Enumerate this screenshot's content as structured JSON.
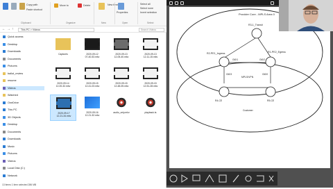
{
  "ribbon": {
    "copy_path": "Copy path",
    "paste_shortcut": "Paste shortcut",
    "move_to": "Move to",
    "delete": "Delete",
    "new_item": "New item",
    "properties": "Properties",
    "select_all": "Select all",
    "select_none": "Select none",
    "invert_selection": "Invert selection",
    "groups": [
      "Clipboard",
      "Organize",
      "New",
      "Open",
      "Select"
    ]
  },
  "address": {
    "path": "This PC  >  Videos",
    "search_placeholder": "Search Videos"
  },
  "sidebar": {
    "items": [
      {
        "label": "Quick access",
        "color": "#2b7cd3"
      },
      {
        "label": "Desktop",
        "color": "#3a8ee6"
      },
      {
        "label": "Downloads",
        "color": "#2b7cd3"
      },
      {
        "label": "Documents",
        "color": "#8a8a8a"
      },
      {
        "label": "Pictures",
        "color": "#3a8ee6"
      },
      {
        "label": "ballot_review",
        "color": "#e8c35a"
      },
      {
        "label": "resume",
        "color": "#e8c35a"
      },
      {
        "label": "Videos",
        "color": "#6b5fb5"
      },
      {
        "label": "Watched",
        "color": "#e8c35a"
      },
      {
        "label": "OneDrive",
        "color": "#2b7cd3"
      },
      {
        "label": "This PC",
        "color": "#2b7cd3"
      },
      {
        "label": "3D Objects",
        "color": "#3a8ee6"
      },
      {
        "label": "Desktop",
        "color": "#3a8ee6"
      },
      {
        "label": "Documents",
        "color": "#8a8a8a"
      },
      {
        "label": "Downloads",
        "color": "#2b7cd3"
      },
      {
        "label": "Music",
        "color": "#2b7cd3"
      },
      {
        "label": "Pictures",
        "color": "#3a8ee6"
      },
      {
        "label": "Videos",
        "color": "#6b5fb5"
      },
      {
        "label": "Local Disk (C:)",
        "color": "#8a8a8a"
      },
      {
        "label": "Network",
        "color": "#2b7cd3"
      }
    ],
    "selected_index": 7
  },
  "files": [
    {
      "name": "Captures",
      "kind": "folder"
    },
    {
      "name": "2020-09-12\n07-40-53.mkv",
      "kind": "video-dark"
    },
    {
      "name": "2020-09-13\n12-05-40.mkv",
      "kind": "video-grey"
    },
    {
      "name": "2020-09-13\n12-11-15.mkv",
      "kind": "video-light"
    },
    {
      "name": "2020-09-14\n12-00-32.mkv",
      "kind": "video-light"
    },
    {
      "name": "2020-09-15\n12-41-03.mkv",
      "kind": "video-light"
    },
    {
      "name": "2020-09-15\n12-48-05.mkv",
      "kind": "video-light"
    },
    {
      "name": "2020-09-15\n12-51-28.mkv",
      "kind": "video-light"
    },
    {
      "name": "2020-09-17\n12-21-34.mkv",
      "kind": "video-blue"
    },
    {
      "name": "2020-09-16\n12-21-32.mkv",
      "kind": "video-play"
    },
    {
      "name": "audio_only.mkv",
      "kind": "disc"
    },
    {
      "name": "playback.ts",
      "kind": "disc"
    }
  ],
  "status": {
    "text": "13 items    1 item selected  286 MB"
  },
  "diagram": {
    "title": "Provider Core - MPLS Area 0",
    "labels": [
      "R3-1_Transit",
      "R2-PE1_Ingress",
      "R1-PE2_Egress",
      "Gi0/1",
      "Gi0/2",
      "Gi0/3",
      "Gi0/0",
      "R4-CE",
      "R5-CE",
      "Customer",
      "MPLS/VPN"
    ]
  },
  "colors": {
    "selection": "#cce8ff",
    "folder": "#e8c35a",
    "accent": "#0078d7",
    "dark": "#1c1c1c"
  }
}
